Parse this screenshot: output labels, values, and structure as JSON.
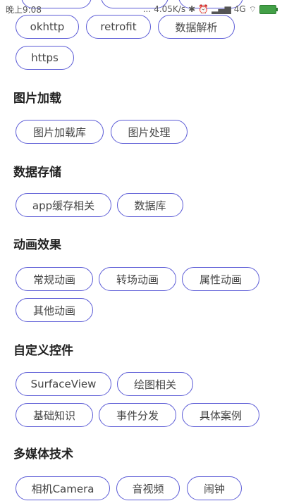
{
  "status_bar": {
    "time": "晚上9:08",
    "dots": "...",
    "speed": "4.05K/s",
    "network": "4G",
    "battery_color": "#43a047"
  },
  "top_row": {
    "chips": [
      "okhttp",
      "retrofit",
      "数据解析",
      "https"
    ]
  },
  "sections": [
    {
      "title": "图片加载",
      "chips": [
        "图片加载库",
        "图片处理"
      ]
    },
    {
      "title": "数据存储",
      "chips": [
        "app缓存相关",
        "数据库"
      ]
    },
    {
      "title": "动画效果",
      "chips": [
        "常规动画",
        "转场动画",
        "属性动画",
        "其他动画"
      ]
    },
    {
      "title": "自定义控件",
      "chips": [
        "SurfaceView",
        "绘图相关",
        "基础知识",
        "事件分发",
        "具体案例"
      ]
    },
    {
      "title": "多媒体技术",
      "chips": [
        "相机Camera",
        "音视频",
        "闹钟"
      ]
    }
  ],
  "accent_color": "#5b5bd6"
}
